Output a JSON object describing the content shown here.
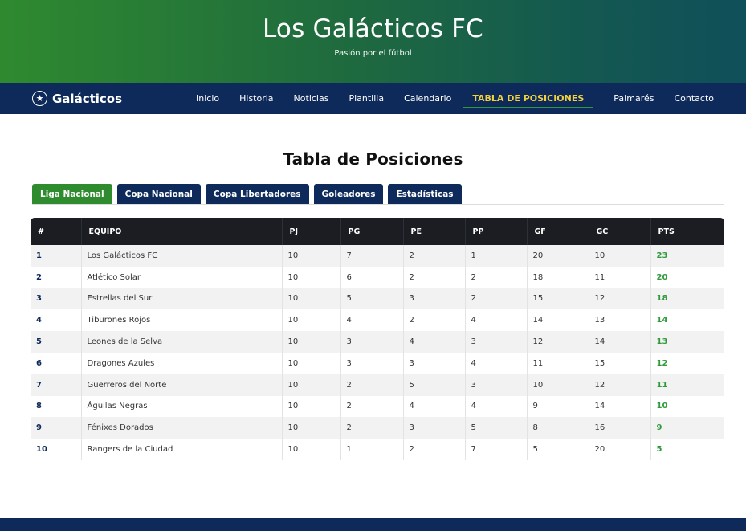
{
  "hero": {
    "title": "Los Galácticos FC",
    "subtitle": "Pasión por el fútbol"
  },
  "navbar": {
    "brand": "Galácticos",
    "links": [
      "Inicio",
      "Historia",
      "Noticias",
      "Plantilla",
      "Calendario",
      "TABLA DE POSICIONES",
      "Palmarés",
      "Contacto"
    ],
    "active_index": 5
  },
  "page_title": "Tabla de Posiciones",
  "tabs": [
    "Liga Nacional",
    "Copa Nacional",
    "Copa Libertadores",
    "Goleadores",
    "Estadísticas"
  ],
  "table": {
    "headers": [
      "#",
      "EQUIPO",
      "PJ",
      "PG",
      "PE",
      "PP",
      "GF",
      "GC",
      "PTS"
    ],
    "rows": [
      [
        "1",
        "Los Galácticos FC",
        "10",
        "7",
        "2",
        "1",
        "20",
        "10",
        "23"
      ],
      [
        "2",
        "Atlético Solar",
        "10",
        "6",
        "2",
        "2",
        "18",
        "11",
        "20"
      ],
      [
        "3",
        "Estrellas del Sur",
        "10",
        "5",
        "3",
        "2",
        "15",
        "12",
        "18"
      ],
      [
        "4",
        "Tiburones Rojos",
        "10",
        "4",
        "2",
        "4",
        "14",
        "13",
        "14"
      ],
      [
        "5",
        "Leones de la Selva",
        "10",
        "3",
        "4",
        "3",
        "12",
        "14",
        "13"
      ],
      [
        "6",
        "Dragones Azules",
        "10",
        "3",
        "3",
        "4",
        "11",
        "15",
        "12"
      ],
      [
        "7",
        "Guerreros del Norte",
        "10",
        "2",
        "5",
        "3",
        "10",
        "12",
        "11"
      ],
      [
        "8",
        "Águilas Negras",
        "10",
        "2",
        "4",
        "4",
        "9",
        "14",
        "10"
      ],
      [
        "9",
        "Fénixes Dorados",
        "10",
        "2",
        "3",
        "5",
        "8",
        "16",
        "9"
      ],
      [
        "10",
        "Rangers de la Ciudad",
        "10",
        "1",
        "2",
        "7",
        "5",
        "20",
        "5"
      ]
    ]
  },
  "colors": {
    "navy": "#0e2a5a",
    "green": "#2e8b2e",
    "gold": "#f2d23a",
    "table_header": "#1c1d22"
  }
}
